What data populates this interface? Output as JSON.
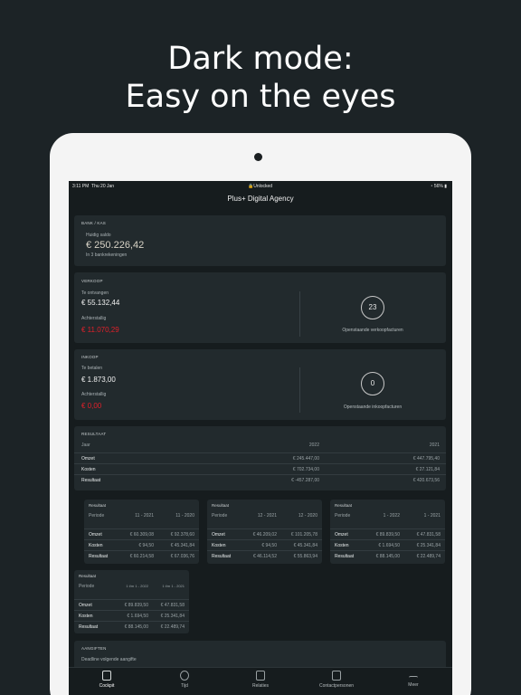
{
  "headline": {
    "line1": "Dark mode:",
    "line2": "Easy on the eyes"
  },
  "status": {
    "time": "3:11 PM",
    "day": "Thu 20 Jan",
    "lock": "Unlocked",
    "battery": "56%"
  },
  "nav": {
    "title": "Plus+ Digital Agency"
  },
  "bank": {
    "section": "BANK / KAS",
    "label": "Huidig saldo",
    "amount": "€ 250.226,42",
    "sub": "In 3 bankrekeningen"
  },
  "verkoop": {
    "section": "VERKOOP",
    "receivable_label": "Te ontvangen",
    "receivable": "€ 55.132,44",
    "overdue_label": "Achterstallig",
    "overdue": "€ 11.070,29",
    "count": "23",
    "count_label": "Openstaande verkoopfacturen"
  },
  "inkoop": {
    "section": "INKOOP",
    "payable_label": "Te betalen",
    "payable": "€ 1.873,00",
    "overdue_label": "Achterstallig",
    "overdue": "€ 0,00",
    "count": "0",
    "count_label": "Openstaande inkoopfacturen"
  },
  "resultaat": {
    "section": "RESULTAAT",
    "headers": [
      "Jaar",
      "2022",
      "2021"
    ],
    "rows": [
      [
        "Omzet",
        "€ 245.447,00",
        "€ 447.795,40"
      ],
      [
        "Kosten",
        "€ 702.734,00",
        "€ 27.121,84"
      ],
      [
        "Resultaat",
        "€ -457.287,00",
        "€ 420.673,56"
      ]
    ]
  },
  "mini_cards": [
    {
      "title": "Resultaat",
      "headers": [
        "Periode",
        "11 - 2021",
        "11 - 2020"
      ],
      "rows": [
        [
          "Omzet",
          "€ 60.309,08",
          "€ 92.378,60"
        ],
        [
          "Kosten",
          "€ 94,50",
          "€ 45.341,84"
        ],
        [
          "Resultaat",
          "€ 60.214,58",
          "€ 67.036,76"
        ]
      ]
    },
    {
      "title": "Resultaat",
      "headers": [
        "Periode",
        "12 - 2021",
        "12 - 2020"
      ],
      "rows": [
        [
          "Omzet",
          "€ 46.209,02",
          "€ 101.205,78"
        ],
        [
          "Kosten",
          "€ 94,50",
          "€ 45.341,84"
        ],
        [
          "Resultaat",
          "€ 46.114,52",
          "€ 55.863,94"
        ]
      ]
    },
    {
      "title": "Resultaat",
      "headers": [
        "Periode",
        "1 - 2022",
        "1 - 2021"
      ],
      "rows": [
        [
          "Omzet",
          "€ 89.839,50",
          "€ 47.831,58"
        ],
        [
          "Kosten",
          "€ 1.694,50",
          "€ 25.341,84"
        ],
        [
          "Resultaat",
          "€ 88.145,00",
          "€ 22.489,74"
        ]
      ]
    },
    {
      "title": "Resultaat",
      "headers": [
        "Periode",
        "1 t/m 1 - 2022",
        "1 t/m 1 - 2021"
      ],
      "rows": [
        [
          "Omzet",
          "€ 89.839,50",
          "€ 47.831,58"
        ],
        [
          "Kosten",
          "€ 1.694,50",
          "€ 25.341,84"
        ],
        [
          "Resultaat",
          "€ 88.145,00",
          "€ 22.489,74"
        ]
      ]
    }
  ],
  "aangiften": {
    "section": "AANGIFTEN",
    "sub": "Deadline volgende aangifte"
  },
  "tabs": [
    {
      "label": "Cockpit",
      "icon": "laptop-icon"
    },
    {
      "label": "Tijd",
      "icon": "clock-people-icon"
    },
    {
      "label": "Relaties",
      "icon": "contacts-book-icon"
    },
    {
      "label": "Contactpersonen",
      "icon": "contact-card-icon"
    },
    {
      "label": "Meer",
      "icon": "more-icon"
    }
  ]
}
